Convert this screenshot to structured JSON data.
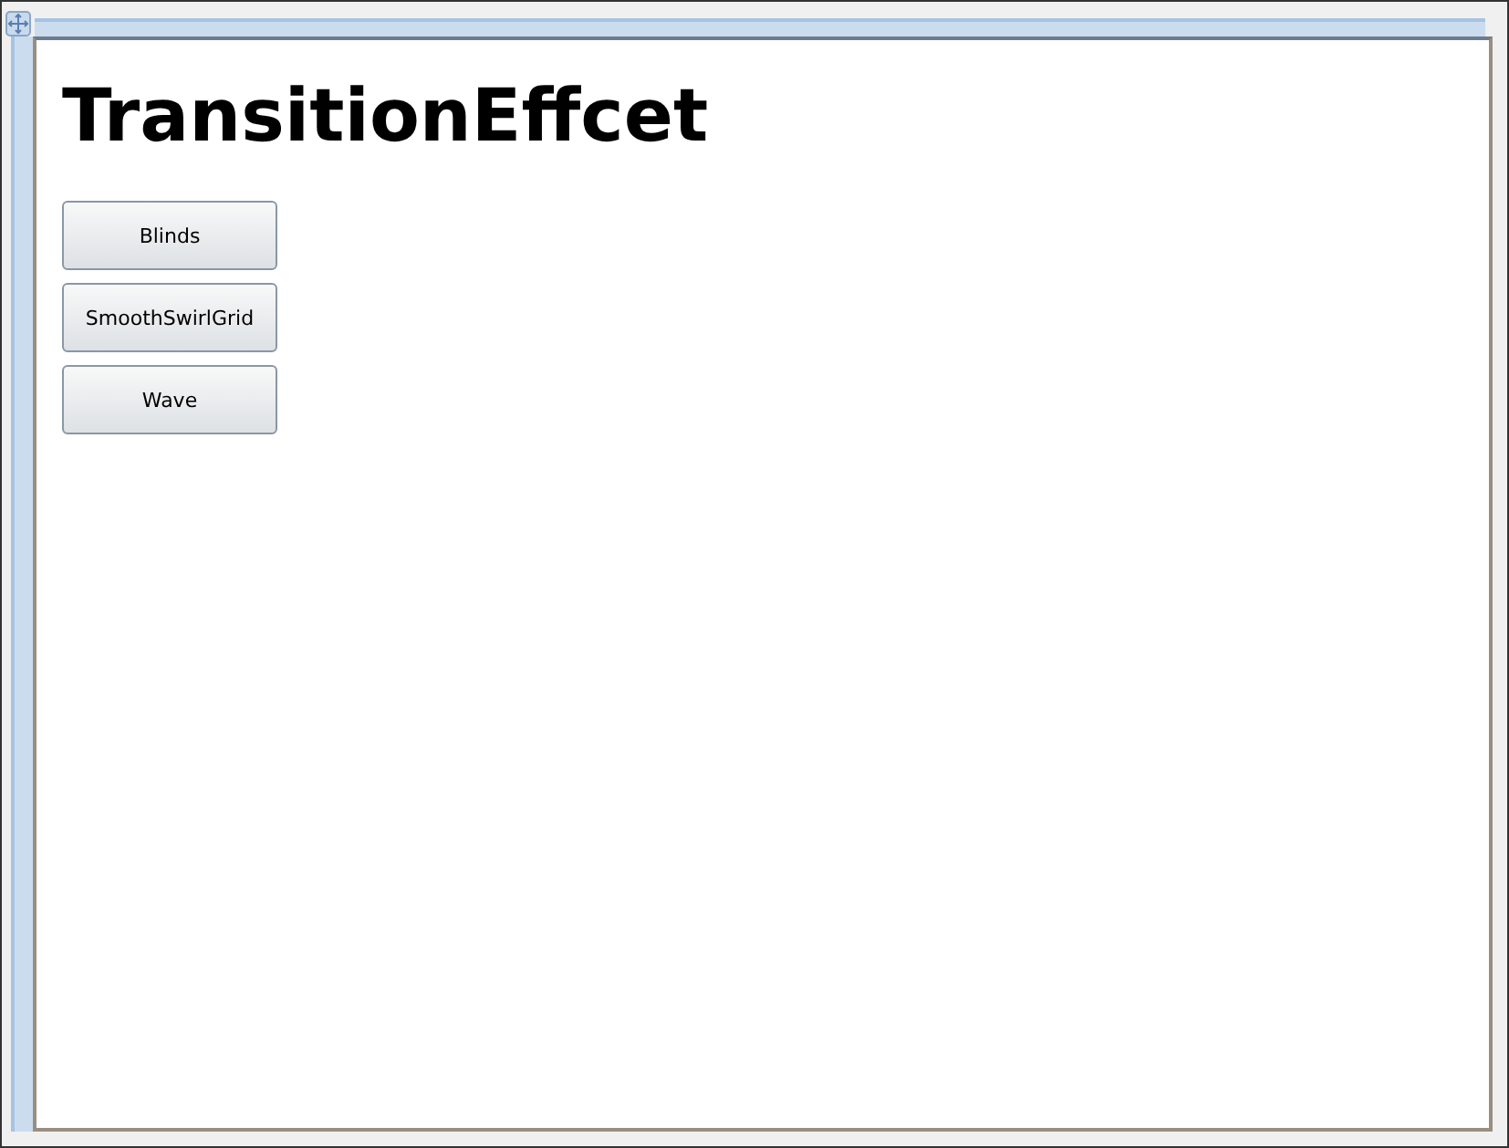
{
  "heading": "TransitionEffcet",
  "buttons": [
    {
      "label": "Blinds"
    },
    {
      "label": "SmoothSwirlGrid"
    },
    {
      "label": "Wave"
    }
  ]
}
